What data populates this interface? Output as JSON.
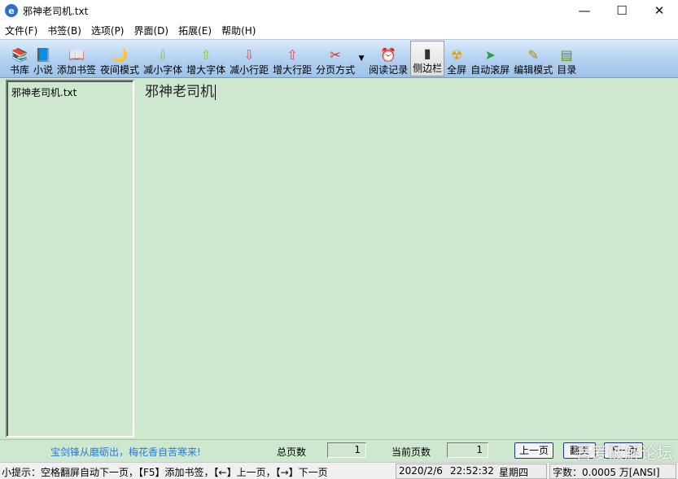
{
  "window": {
    "title": "邪神老司机.txt",
    "app_icon_glyph": "e",
    "minimize": "—",
    "maximize": "☐",
    "close": "✕"
  },
  "menu": [
    "文件(F)",
    "书签(B)",
    "选项(P)",
    "界面(D)",
    "拓展(E)",
    "帮助(H)"
  ],
  "toolbar": {
    "buttons": [
      {
        "label": "书库",
        "icon": "bookshelf-icon",
        "glyph": "📚",
        "color": "#d0327a"
      },
      {
        "label": "小说",
        "icon": "book-icon",
        "glyph": "📘",
        "color": "#2b5fc2"
      },
      {
        "label": "添加书签",
        "icon": "bookmark-icon",
        "glyph": "📖",
        "color": "#222222"
      },
      {
        "label": "夜间模式",
        "icon": "night-mode-icon",
        "glyph": "🌙",
        "color": "#1b3b8a"
      },
      {
        "label": "减小字体",
        "icon": "font-decrease-icon",
        "glyph": "⇩",
        "color": "#8cc43c"
      },
      {
        "label": "增大字体",
        "icon": "font-increase-icon",
        "glyph": "⇧",
        "color": "#8cc43c"
      },
      {
        "label": "减小行距",
        "icon": "line-spacing-decrease-icon",
        "glyph": "⇩",
        "color": "#e24a4a"
      },
      {
        "label": "增大行距",
        "icon": "line-spacing-increase-icon",
        "glyph": "⇧",
        "color": "#e24a4a"
      },
      {
        "label": "分页方式",
        "icon": "pagination-icon",
        "glyph": "✂",
        "color": "#c0392b"
      },
      {
        "label": "阅读记录",
        "icon": "reading-history-icon",
        "glyph": "⏰",
        "color": "#333333"
      },
      {
        "label": "侧边栏",
        "icon": "sidebar-icon",
        "glyph": "▮",
        "color": "#333333",
        "active": true
      },
      {
        "label": "全屏",
        "icon": "fullscreen-icon",
        "glyph": "☢",
        "color": "#e0a000"
      },
      {
        "label": "自动滚屏",
        "icon": "auto-scroll-icon",
        "glyph": "➤",
        "color": "#1f9e4a"
      },
      {
        "label": "编辑模式",
        "icon": "edit-mode-icon",
        "glyph": "✎",
        "color": "#b8860b"
      },
      {
        "label": "目录",
        "icon": "toc-icon",
        "glyph": "▤",
        "color": "#6a8a2a"
      }
    ],
    "dropdown_glyph": "▼"
  },
  "sidebar": {
    "items": [
      "邪神老司机.txt"
    ]
  },
  "reader": {
    "text": "邪神老司机"
  },
  "infobar": {
    "motto": "宝剑锋从磨砺出，梅花香自苦寒来!",
    "total_pages_label": "总页数",
    "total_pages": "1",
    "current_page_label": "当前页数",
    "current_page": "1",
    "prev_page": "上一页",
    "flip_page": "翻页",
    "next_page": "下一页"
  },
  "statusbar": {
    "tip": "小提示：空格翻屏自动下一页，【F5】添加书签，【←】上一页，【→】下一页",
    "date": "2020/2/6",
    "time": "22:52:32",
    "weekday": "星期四",
    "word_count": "字数：0.0005 万[ANSI]"
  },
  "watermark": "吾爱破解论坛",
  "colors": {
    "reader_bg": "#cde8cf",
    "motto": "#2a7bd6"
  }
}
